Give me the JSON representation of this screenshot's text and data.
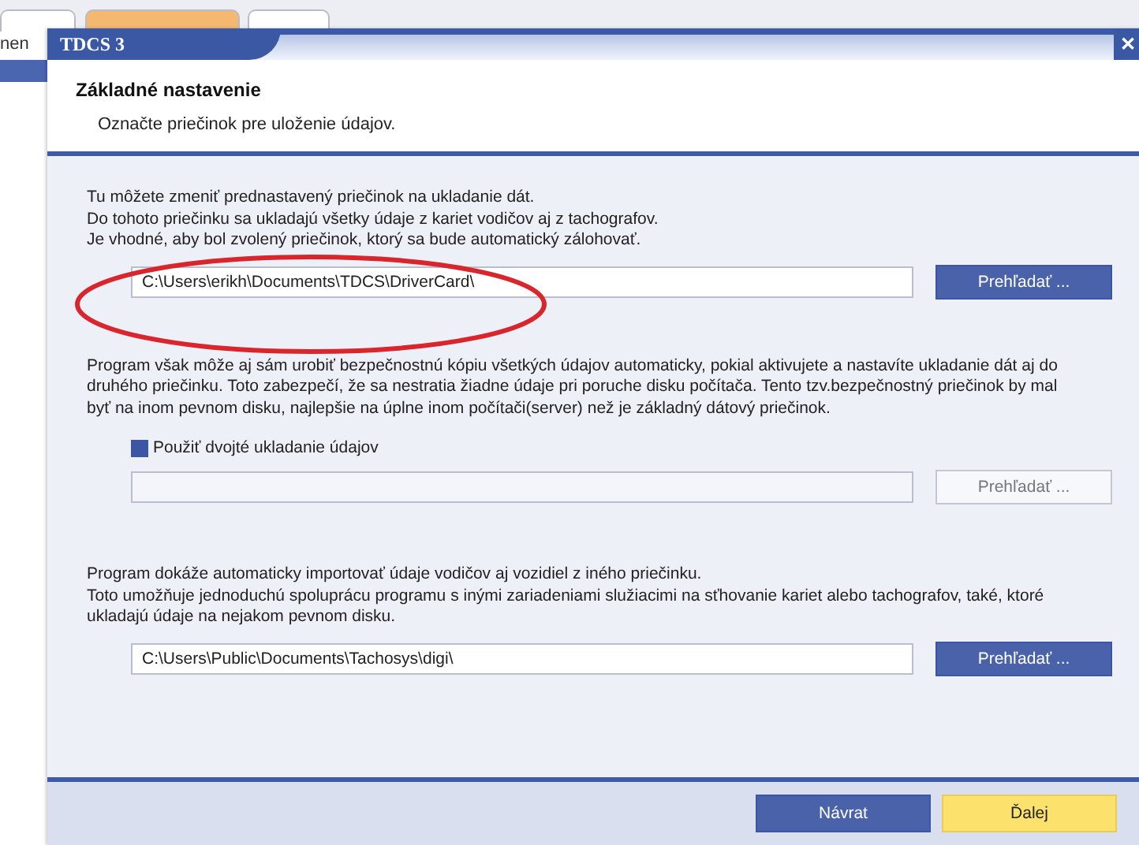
{
  "background": {
    "side_text": "nen"
  },
  "window": {
    "title": "TDCS 3",
    "close": "✕"
  },
  "header": {
    "title": "Základné nastavenie",
    "subtitle": "Označte priečinok pre uloženie údajov."
  },
  "sections": [
    {
      "lines": [
        "Tu môžete zmeniť prednastavený priečinok na ukladanie dát.",
        "Do tohoto priečinku sa ukladajú všetky údaje z kariet vodičov aj z tachografov.",
        "Je vhodné, aby bol zvolený priečinok, ktorý sa bude automatický zálohovať."
      ],
      "field": {
        "value": "C:\\Users\\erikh\\Documents\\TDCS\\DriverCard\\"
      },
      "browse": {
        "label": "Prehľadať ...",
        "disabled": false
      },
      "annotated": true
    },
    {
      "lines": [
        "Program však môže aj sám urobiť bezpečnostnú kópiu všetkých údajov automaticky, pokial aktivujete a nastavíte ukladanie dát aj do",
        "druhého priečinku. Toto zabezpečí, že sa nestratia žiadne údaje pri poruche disku počítača. Tento tzv.bezpečnostný priečinok by mal",
        "byť na inom pevnom disku, najlepšie na úplne inom počítači(server) než je základný dátový priečinok."
      ],
      "checkbox": {
        "label": "Použiť dvojté ukladanie údajov",
        "checked": true
      },
      "browse": {
        "label": "Prehľadať ...",
        "disabled": true
      }
    },
    {
      "lines": [
        "Program dokáže automaticky importovať údaje vodičov aj vozidiel z iného priečinku.",
        "Toto umožňuje jednoduchú spoluprácu programu s inými zariadeniami služiacimi na sťhovanie kariet alebo tachografov, také, ktoré",
        "ukladajú údaje na nejakom pevnom disku."
      ],
      "field": {
        "value": "C:\\Users\\Public\\Documents\\Tachosys\\digi\\"
      },
      "browse": {
        "label": "Prehľadať ...",
        "disabled": false
      }
    }
  ],
  "footer": {
    "buttons": [
      {
        "label": "Návrat",
        "kind": "secondary"
      },
      {
        "label": "Ďalej",
        "kind": "primary"
      }
    ]
  }
}
